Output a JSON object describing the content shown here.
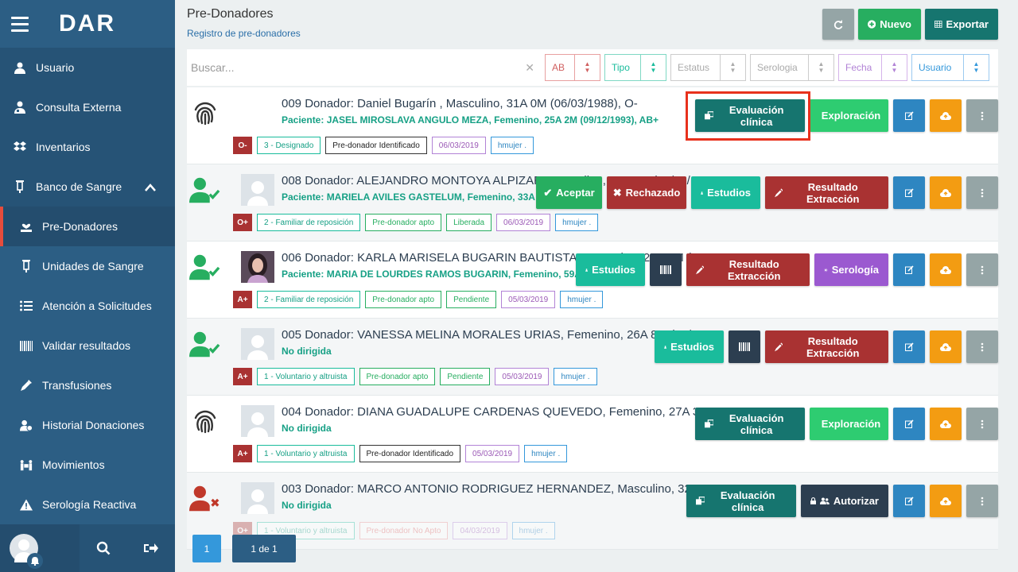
{
  "sidebar": {
    "logo": "DAR",
    "items": [
      {
        "label": "Usuario"
      },
      {
        "label": "Consulta Externa"
      },
      {
        "label": "Inventarios"
      },
      {
        "label": "Banco de Sangre"
      },
      {
        "label": "Pre-Donadores"
      },
      {
        "label": "Unidades de Sangre"
      },
      {
        "label": "Atención a Solicitudes"
      },
      {
        "label": "Validar resultados"
      },
      {
        "label": "Transfusiones"
      },
      {
        "label": "Historial Donaciones"
      },
      {
        "label": "Movimientos"
      },
      {
        "label": "Serología Reactiva"
      }
    ]
  },
  "header": {
    "title": "Pre-Donadores",
    "subtitle": "Registro de pre-donadores",
    "nuevo": "Nuevo",
    "exportar": "Exportar"
  },
  "filters": {
    "search_placeholder": "Buscar...",
    "ab": "AB",
    "tipo": "Tipo",
    "estatus": "Estatus",
    "serologia": "Serologia",
    "fecha": "Fecha",
    "usuario": "Usuario"
  },
  "rows": [
    {
      "line1": "009 Donador: Daniel Bugarín , Masculino, 31A 0M (06/03/1988), O-",
      "line2": "Paciente: JASEL MIROSLAVA ANGULO MEZA, Femenino, 25A 2M (09/12/1993), AB+",
      "blood": "O-",
      "tags": [
        "3 - Designado",
        "Pre-donador Identificado",
        "06/03/2019",
        "hmujer ."
      ],
      "actions": [
        "Evaluación clínica",
        "Exploración"
      ]
    },
    {
      "line1": "008 Donador: ALEJANDRO MONTOYA ALPIZAR, Masculino, 46A 0M (06/12/1972), O+",
      "line2": "Paciente: MARIELA AVILES GASTELUM, Femenino, 33A 8M",
      "blood": "O+",
      "tags": [
        "2 - Familiar de reposición",
        "Pre-donador apto",
        "Liberada",
        "06/03/2019",
        "hmujer ."
      ],
      "actions": [
        "Aceptar",
        "Rechazado",
        "Estudios",
        "Resultado Extracción"
      ]
    },
    {
      "line1": "006 Donador: KARLA MARISELA BUGARIN BAUTISTA, Femenino, 28A 7M (02/08/1990), A+",
      "line2": "Paciente: MARIA DE LOURDES RAMOS BUGARIN, Femenino, 59A 9M",
      "blood": "A+",
      "tags": [
        "2 - Familiar de reposición",
        "Pre-donador apto",
        "Pendiente",
        "05/03/2019",
        "hmujer ."
      ],
      "actions": [
        "Estudios",
        "Resultado Extracción",
        "Serología"
      ]
    },
    {
      "line1": "005 Donador: VANESSA MELINA MORALES URIAS, Femenino, 26A 8M (07/06/1992), A+",
      "line2": "No dirigida",
      "blood": "A+",
      "tags": [
        "1 - Voluntario y altruista",
        "Pre-donador apto",
        "Pendiente",
        "05/03/2019",
        "hmujer ."
      ],
      "actions": [
        "Estudios",
        "Resultado Extracción"
      ]
    },
    {
      "line1": "004 Donador: DIANA GUADALUPE CARDENAS QUEVEDO, Femenino, 27A 3M (02/12/1991), A+",
      "line2": "No dirigida",
      "blood": "A+",
      "tags": [
        "1 - Voluntario y altruista",
        "Pre-donador Identificado",
        "05/03/2019",
        "hmujer ."
      ],
      "actions": [
        "Evaluación clínica",
        "Exploración"
      ]
    },
    {
      "line1": "003 Donador: MARCO ANTONIO RODRIGUEZ HERNANDEZ, Masculino, 32A 11M (07/04/1986), O+",
      "line2": "No dirigida",
      "blood": "O+",
      "tags": [
        "1 - Voluntario y altruista",
        "Pre-donador No Apto",
        "04/03/2019",
        "hmujer ."
      ],
      "actions": [
        "Evaluación clínica",
        "Autorizar"
      ]
    }
  ],
  "pager": {
    "page": "1",
    "of": "1 de 1"
  }
}
